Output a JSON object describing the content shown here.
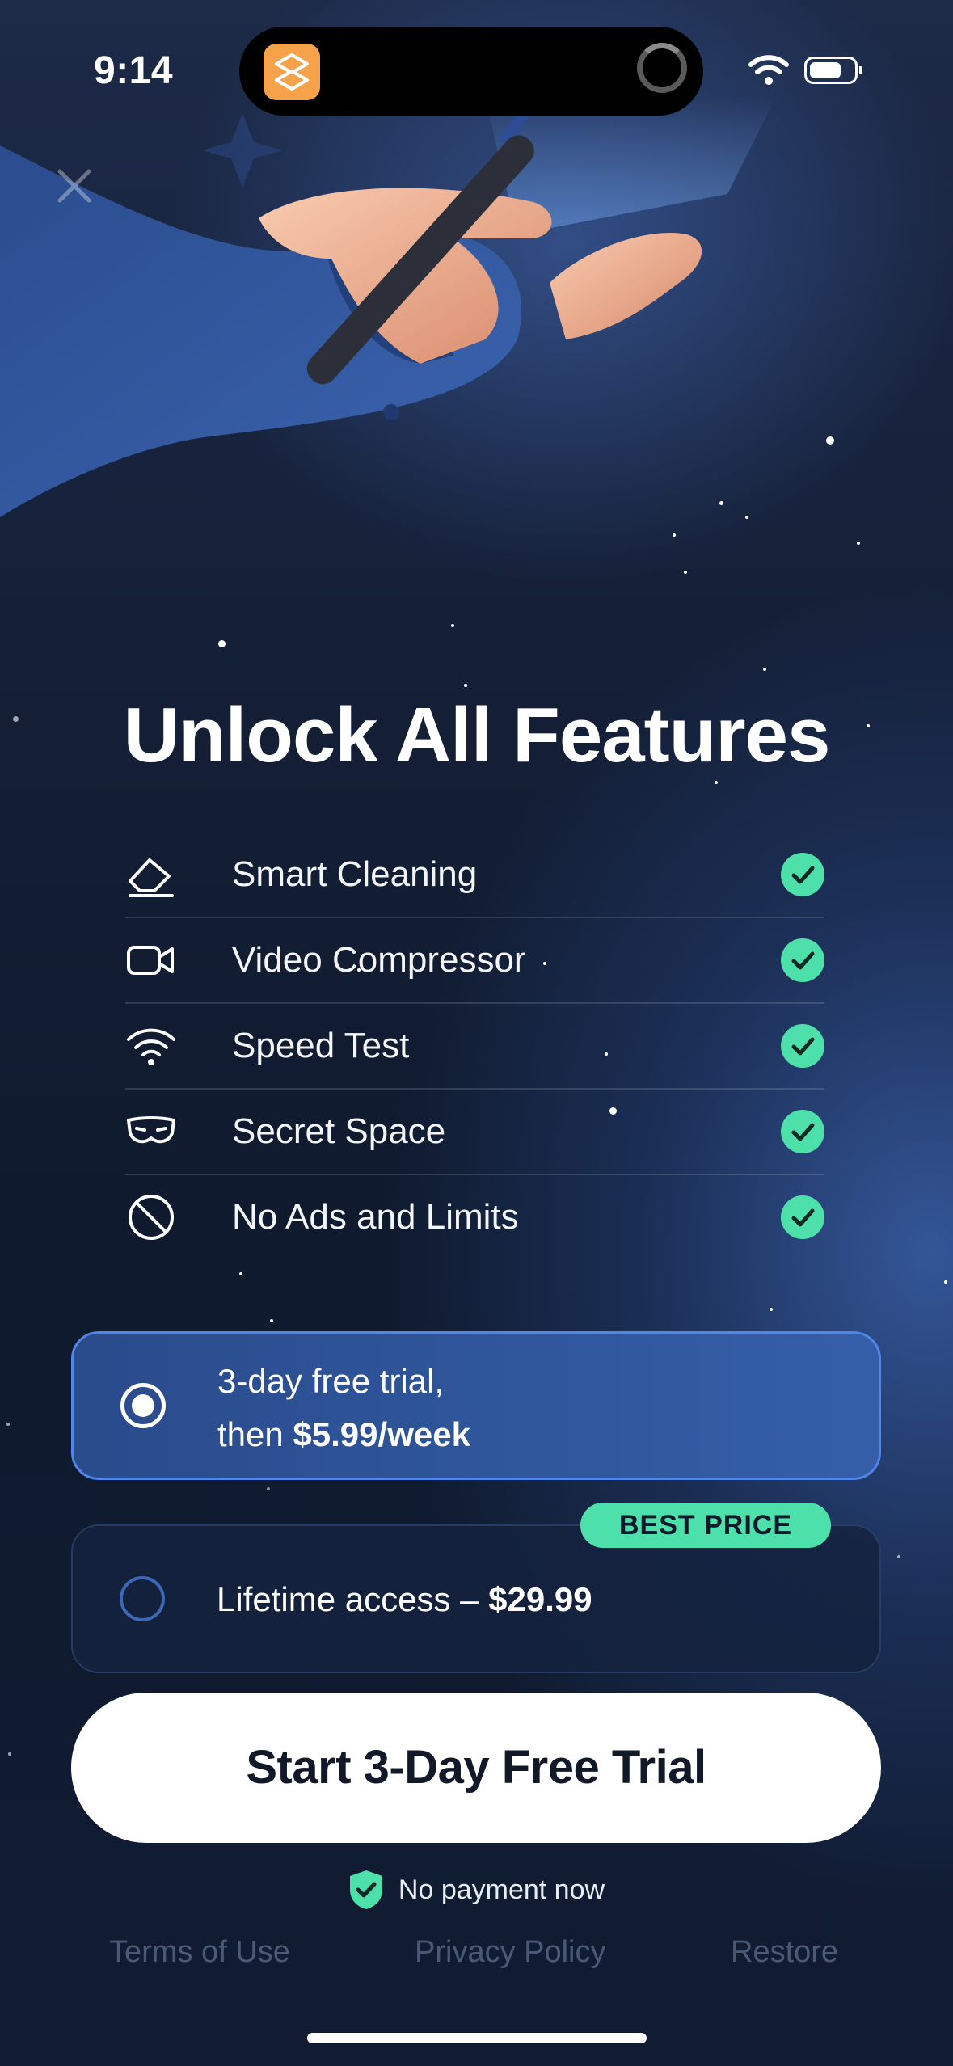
{
  "status_bar": {
    "time": "9:14",
    "wifi_icon": "wifi-icon",
    "battery_icon": "battery-icon",
    "battery_level": 0.7
  },
  "close_icon": "close-icon",
  "title": "Unlock All Features",
  "features": [
    {
      "label": "Smart Cleaning",
      "icon": "eraser-icon"
    },
    {
      "label": "Video Compressor",
      "icon": "video-camera-icon"
    },
    {
      "label": "Speed Test",
      "icon": "wifi-icon"
    },
    {
      "label": "Secret Space",
      "icon": "mask-icon"
    },
    {
      "label": "No Ads and Limits",
      "icon": "no-sign-icon"
    }
  ],
  "plans": {
    "trial": {
      "line1": "3-day free trial,",
      "line2_prefix": "then ",
      "line2_price": "$5.99/week",
      "selected": true
    },
    "lifetime": {
      "prefix": "Lifetime access – ",
      "price": "$29.99",
      "selected": false,
      "badge": "BEST PRICE"
    }
  },
  "cta_label": "Start 3-Day Free Trial",
  "no_payment": "No payment now",
  "footer": {
    "terms": "Terms of Use",
    "privacy": "Privacy Policy",
    "restore": "Restore"
  },
  "colors": {
    "accent_green": "#4ee0aa",
    "selected_plan": "#345fa8",
    "selected_border": "#4f86e8",
    "background": "#0f1a2e"
  }
}
